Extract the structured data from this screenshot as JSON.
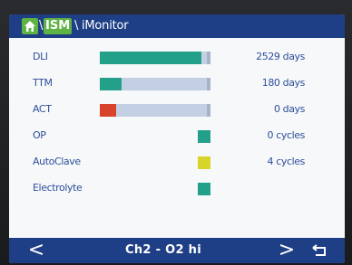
{
  "header": {
    "separator": "\\",
    "ism_label": "ISM",
    "title": "iMonitor"
  },
  "colors": {
    "header_bg": "#1e3f86",
    "accent_green": "#5fb244",
    "teal": "#22a08a",
    "red": "#d8432c",
    "yellow": "#d7d42a",
    "track": "#c3cfe3",
    "text_blue": "#2d4f9a"
  },
  "rows": [
    {
      "label": "DLI",
      "value": "2529 days",
      "type": "bar",
      "fill_fraction": 0.95,
      "color": "#22a08a"
    },
    {
      "label": "TTM",
      "value": "180 days",
      "type": "bar",
      "fill_fraction": 0.2,
      "color": "#22a08a"
    },
    {
      "label": "ACT",
      "value": "0 days",
      "type": "bar",
      "fill_fraction": 0.15,
      "color": "#d8432c"
    },
    {
      "label": "OP",
      "value": "0 cycles",
      "type": "square",
      "color": "#22a08a"
    },
    {
      "label": "AutoClave",
      "value": "4 cycles",
      "type": "square",
      "color": "#d7d42a"
    },
    {
      "label": "Electrolyte",
      "value": "",
      "type": "square",
      "color": "#22a08a"
    }
  ],
  "footer": {
    "prev_icon": "chevron-left-icon",
    "prev_glyph": "<",
    "channel": "Ch2 - O2 hi",
    "next_icon": "chevron-right-icon",
    "next_glyph": ">",
    "back_icon": "return-arrow-icon"
  }
}
